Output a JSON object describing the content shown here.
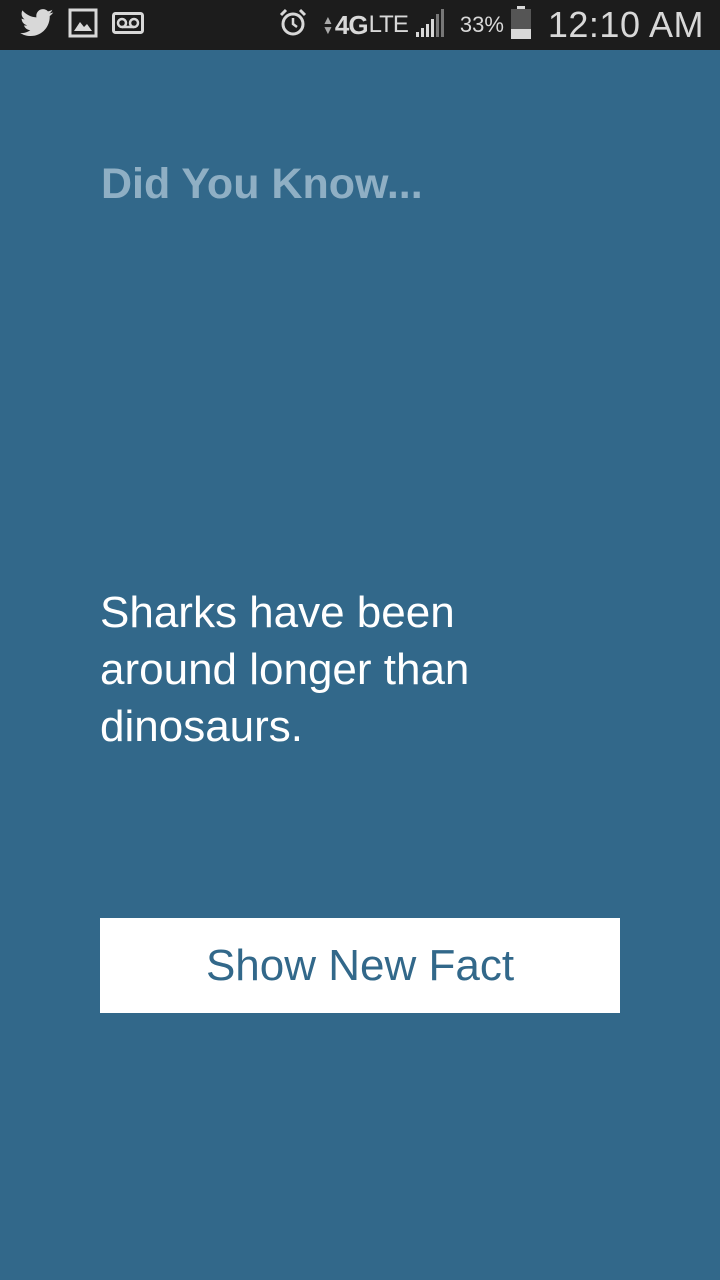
{
  "status_bar": {
    "left_icons": [
      "twitter-icon",
      "image-icon",
      "voicemail-icon"
    ],
    "network": "4G",
    "network_sub": "LTE",
    "battery_percent": "33%",
    "time": "12:10 AM"
  },
  "main": {
    "header": "Did You Know...",
    "fact": "Sharks have been around longer than dinosaurs.",
    "button_label": "Show New Fact"
  },
  "colors": {
    "background": "#32688a",
    "status_bar": "#1c1c1c",
    "header_text": "#8fafc4",
    "button_bg": "#ffffff",
    "button_text": "#32688a"
  }
}
